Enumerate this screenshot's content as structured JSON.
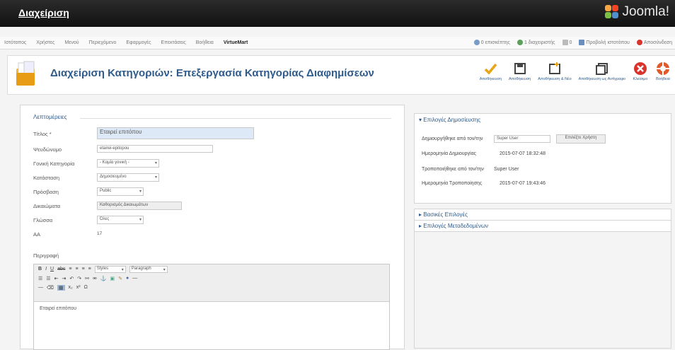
{
  "header": {
    "site_title": "Διαχείριση",
    "brand": "Joomla!"
  },
  "menu": {
    "items": [
      "Ιστότοπος",
      "Χρήστες",
      "Μενού",
      "Περιεχόμενο",
      "Εφαρμογές",
      "Επεκτάσεις",
      "Βοήθεια",
      "VirtueMart"
    ],
    "status": {
      "visitors": "0 επισκέπτης",
      "admins": "1 διαχειριστής",
      "messages": "0",
      "view_site": "Προβολή ιστοτόπου",
      "logout": "Αποσύνδεση"
    }
  },
  "toolbar": {
    "title": "Διαχείριση Κατηγοριών: Επεξεργασία Κατηγορίας Διαφημίσεων",
    "buttons": [
      "Αποθήκευση",
      "Αποθήκευση",
      "Αποθήκευση & Νέο",
      "Αποθήκευση ως Αντίγραφο",
      "Κλείσιμο",
      "Βοήθεια"
    ]
  },
  "form": {
    "legend": "Λεπτομέρειες",
    "labels": {
      "title": "Τίτλος *",
      "alias": "Ψευδώνυμο",
      "parent": "Γονική Κατηγορία",
      "state": "Κατάσταση",
      "access": "Πρόσβαση",
      "permissions": "Δικαιώματα",
      "language": "Γλώσσα",
      "id": "ΑΑ",
      "description": "Περιγραφή"
    },
    "values": {
      "title": "Εταιρεί επιτόπου",
      "alias": "etairei-epitopou",
      "parent": "- Καμία γονική -",
      "state": "Δημοσιευμένο",
      "access": "Public",
      "permissions": "Καθορισμός Δικαιωμάτων",
      "language": "Όλες",
      "id": "17"
    },
    "editor": {
      "styles": "Styles",
      "paragraph": "Paragraph",
      "content": "Εταιρεί επιτόπου"
    }
  },
  "publishing": {
    "header": "Επιλογές Δημοσίευσης",
    "created_by_label": "Δημιουργήθηκε από τον/την",
    "created_by": "Super User",
    "select_user": "Επιλέξτε Χρήστη",
    "created_date_label": "Ημερομηνία Δημιουργίας",
    "created_date": "2015-07-07 18:32:48",
    "modified_by_label": "Τροποποιήθηκε από τον/την",
    "modified_by": "Super User",
    "modified_date_label": "Ημερομηνία Τροποποίησης",
    "modified_date": "2015-07-07 19:43:46"
  },
  "panels": {
    "basic": "Βασικές Επιλογές",
    "metadata": "Επιλογές Μεταδεδομένων"
  },
  "colors": {
    "accent": "#2e5b8c",
    "topbar": "#1a1a1a",
    "save": "#e8a317",
    "close": "#d9342b",
    "help": "#e05a2a"
  }
}
